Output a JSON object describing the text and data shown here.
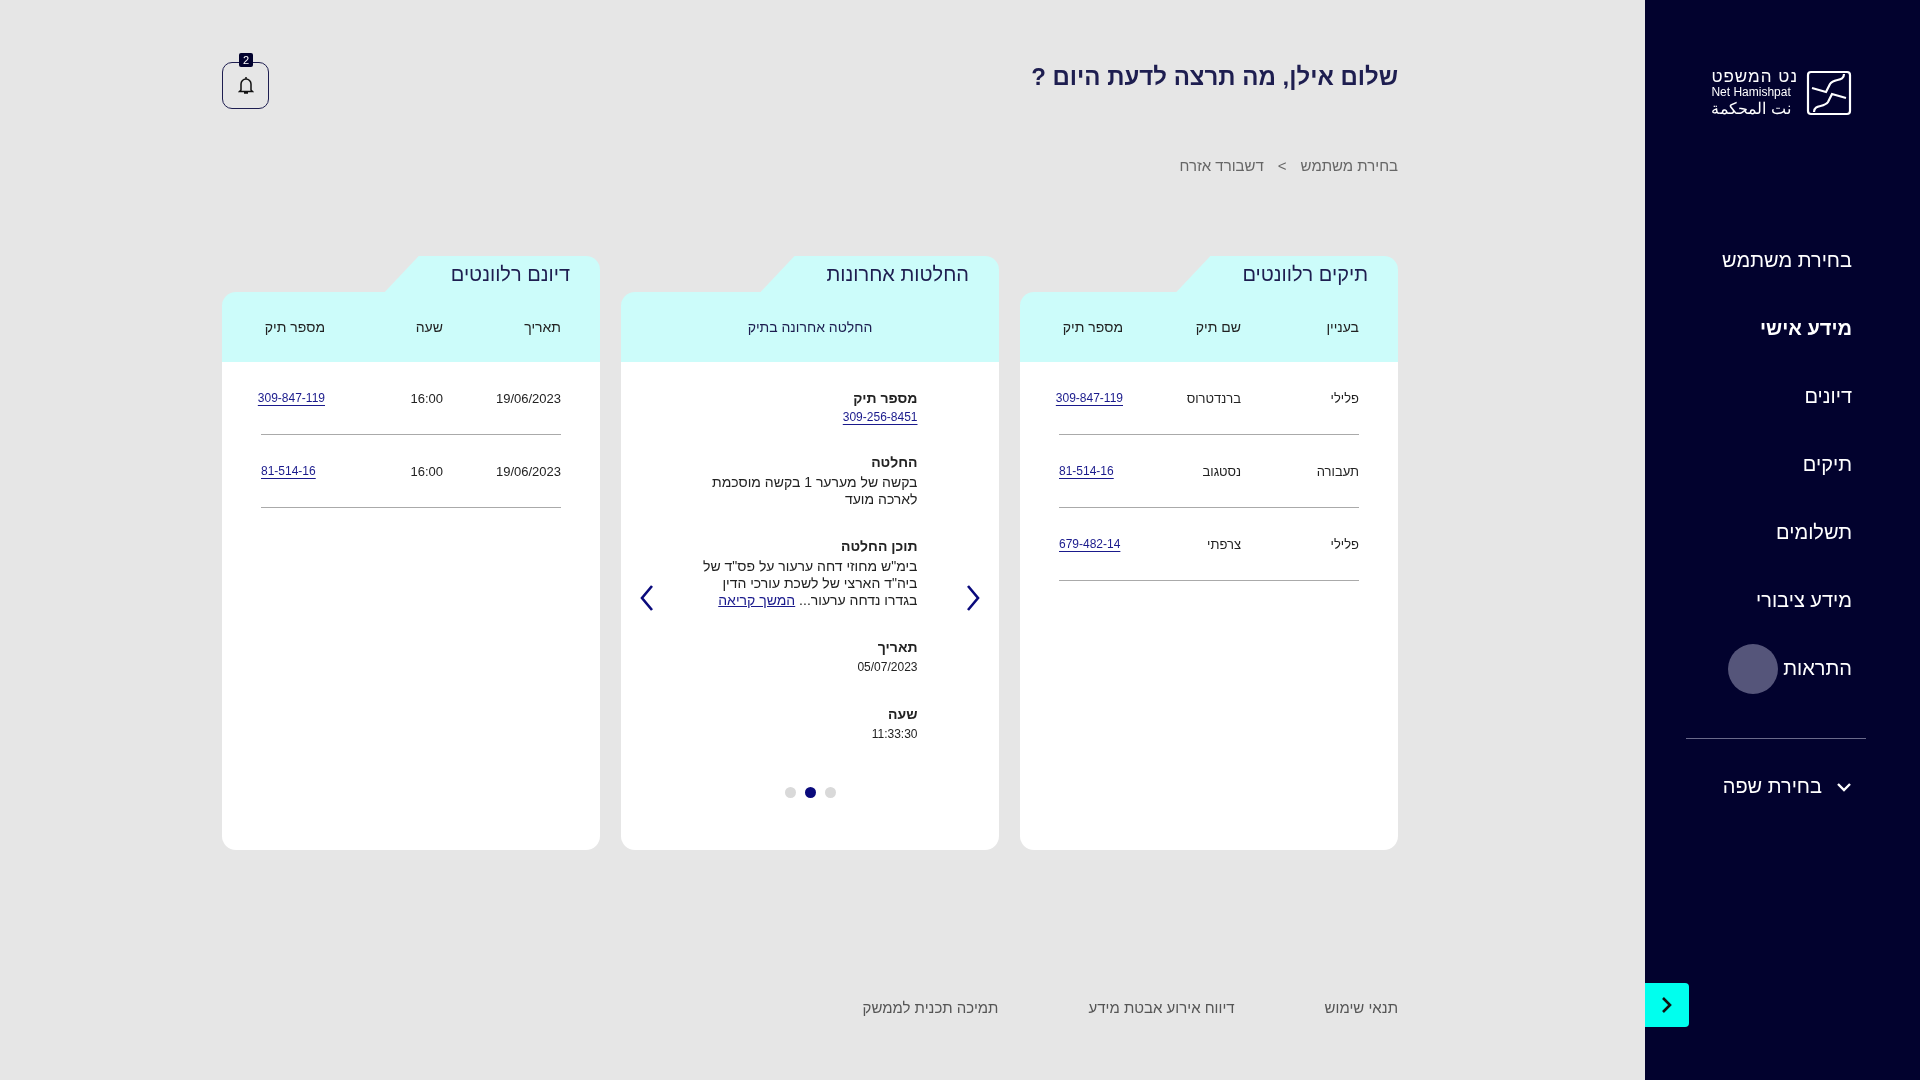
{
  "logo": {
    "hebrew": "נט המשפט",
    "latin": "Net Hamishpat",
    "arabic": "نت المحكمة"
  },
  "sidebar": {
    "items": [
      {
        "label": "בחירת משתמש",
        "selected": false
      },
      {
        "label": "מידע אישי",
        "selected": true
      },
      {
        "label": "דיונים",
        "selected": false
      },
      {
        "label": "תיקים",
        "selected": false
      },
      {
        "label": "תשלומים",
        "selected": false
      },
      {
        "label": "מידע ציבורי",
        "selected": false
      },
      {
        "label": "התראות",
        "selected": false
      }
    ],
    "language": "בחירת שפה"
  },
  "header": {
    "title": "שלום אילן, מה תרצה לדעת היום ?",
    "notifications": "2"
  },
  "breadcrumb": {
    "items": [
      "בחירת משתמש",
      "דשבורד אזרח"
    ],
    "separator": ">"
  },
  "cards": [
    {
      "kind": "table",
      "title": "תיקים רלוונטים",
      "columns": [
        {
          "label": "בעניין",
          "kind": "text"
        },
        {
          "label": "שם תיק",
          "kind": "text"
        },
        {
          "label": "מספר תיק",
          "kind": "link"
        }
      ],
      "rows": [
        [
          "פלילי",
          "ברנדטרוס",
          "309-847-119"
        ],
        [
          "תעבורה",
          "נסטגוב",
          "81-514-16"
        ],
        [
          "פלילי",
          "צרפתי",
          "679-482-14"
        ]
      ]
    },
    {
      "kind": "carousel",
      "title": "החלטות אחרונות",
      "subtitle": "החלטה אחרונה בתיק",
      "fields": [
        {
          "label": "מספר תיק",
          "value": "309-256-8451",
          "kind": "link"
        },
        {
          "label": "החלטה",
          "value": "בקשה של מערער 1 בקשה מוסכמת לארכה מועד",
          "kind": "text"
        },
        {
          "label": "תוכן החלטה",
          "value": "בימ\"ש מחוזי דחה ערעור על פס\"ד של ביה\"ד הארצי של לשכת עורכי הדין בגדרו נדחה ערעור...",
          "more": "המשך קריאה",
          "kind": "text"
        },
        {
          "label": "תאריך",
          "value": "05/07/2023",
          "kind": "small"
        },
        {
          "label": "שעה",
          "value": "11:33:30",
          "kind": "small"
        }
      ],
      "dots": [
        {
          "selected": false
        },
        {
          "selected": true
        },
        {
          "selected": false
        }
      ]
    },
    {
      "kind": "table",
      "title": "דיונם רלוונטים",
      "columns": [
        {
          "label": "תאריך",
          "kind": "text"
        },
        {
          "label": "שעה",
          "kind": "text"
        },
        {
          "label": "מספר תיק",
          "kind": "link"
        }
      ],
      "rows": [
        [
          "19/06/2023",
          "16:00",
          "309-847-119"
        ],
        [
          "19/06/2023",
          "16:00",
          "81-514-16"
        ]
      ]
    }
  ],
  "footer": [
    "תנאי שימוש",
    "דיווח אירוע אבטת מידע",
    "תמיכה תכנית לממשק"
  ]
}
